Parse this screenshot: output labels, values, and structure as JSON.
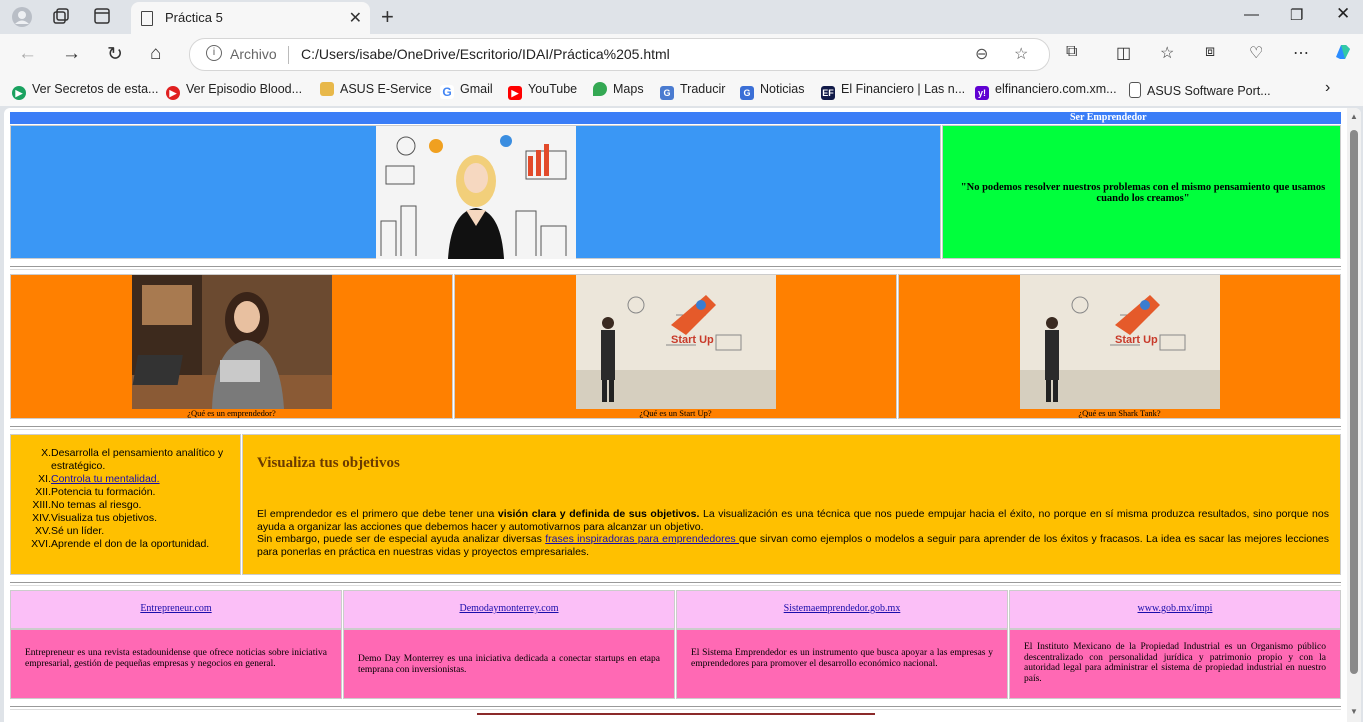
{
  "browser": {
    "tab_title": "Práctica 5",
    "address_label": "Archivo",
    "address_path": "C:/Users/isabe/OneDrive/Escritorio/IDAI/Práctica%205.html",
    "bookmarks": [
      {
        "label": "Ver Secretos de esta...",
        "icon": "play-green-icon",
        "color": "#1aa260"
      },
      {
        "label": "Ver Episodio Blood...",
        "icon": "play-red-icon",
        "color": "#e02020"
      },
      {
        "label": "ASUS E-Service",
        "icon": "folder-icon",
        "color": "#e8b84a"
      },
      {
        "label": "Gmail",
        "icon": "google-icon",
        "color": "#4285f4"
      },
      {
        "label": "YouTube",
        "icon": "youtube-icon",
        "color": "#ff0000"
      },
      {
        "label": "Maps",
        "icon": "maps-icon",
        "color": "#34a853"
      },
      {
        "label": "Traducir",
        "icon": "translate-icon",
        "color": "#4a7bd0"
      },
      {
        "label": "Noticias",
        "icon": "news-icon",
        "color": "#3b6fd6"
      },
      {
        "label": "El Financiero | Las n...",
        "icon": "ef-icon",
        "color": "#111a48"
      },
      {
        "label": "elfinanciero.com.xm...",
        "icon": "yahoo-icon",
        "color": "#6001d2"
      },
      {
        "label": "ASUS Software Port...",
        "icon": "page-icon",
        "color": "#ffffff"
      }
    ]
  },
  "page": {
    "header_title": "Ser Emprendedor",
    "quote": "\"No podemos resolver nuestros problemas con el mismo pensamiento que usamos cuando los creamos\"",
    "gallery": [
      {
        "caption": "¿Qué es un emprendedor?"
      },
      {
        "caption": "¿Qué es un Start Up?"
      },
      {
        "caption": "¿Qué es un Shark Tank?"
      }
    ],
    "list": [
      {
        "num": "X.",
        "text": "Desarrolla el pensamiento analítico y estratégico."
      },
      {
        "num": "XI.",
        "text": "Controla tu mentalidad.",
        "link": true
      },
      {
        "num": "XII.",
        "text": "Potencia tu formación."
      },
      {
        "num": "XIII.",
        "text": "No temas al riesgo."
      },
      {
        "num": "XIV.",
        "text": "Visualiza tus objetivos."
      },
      {
        "num": "XV.",
        "text": "Sé un líder."
      },
      {
        "num": "XVI.",
        "text": "Aprende el don de la oportunidad."
      }
    ],
    "visualiza": {
      "title": "Visualiza tus objetivos",
      "p1_a": "El emprendedor es el primero que debe tener una ",
      "p1_bold": "visión clara y definida de sus objetivos.",
      "p1_b": " La visualización es una técnica que nos puede empujar hacia el éxito, no porque en sí misma produzca resultados, sino porque nos ayuda a organizar las acciones que debemos hacer y automotivarnos para alcanzar un objetivo.",
      "p2_a": "Sin embargo, puede ser de especial ayuda analizar diversas ",
      "p2_link": "frases inspiradoras para emprendedores ",
      "p2_b": "que sirvan como ejemplos o modelos a seguir para aprender de los éxitos y fracasos. La idea es sacar las mejores lecciones para ponerlas en práctica en nuestras vidas y proyectos empresariales."
    },
    "links": [
      {
        "label": "Entrepreneur.com",
        "desc": "Entrepreneur es una revista estadounidense que ofrece noticias sobre iniciativa empresarial, gestión de pequeñas empresas y negocios en general."
      },
      {
        "label": "Demodaymonterrey.com",
        "desc": "Demo Day Monterrey es una iniciativa dedicada a conectar startups en etapa temprana con inversionistas."
      },
      {
        "label": "Sistemaemprendedor.gob.mx",
        "desc": "El Sistema Emprendedor es un instrumento que busca apoyar a las empresas y emprendedores para promover el desarrollo económico nacional."
      },
      {
        "label": "www.gob.mx/impi",
        "desc": "El Instituto Mexicano de la Propiedad Industrial es un Organismo público descentralizado con personalidad jurídica y patrimonio propio y con la autoridad legal para administrar el sistema de propiedad industrial en nuestro país."
      }
    ]
  }
}
